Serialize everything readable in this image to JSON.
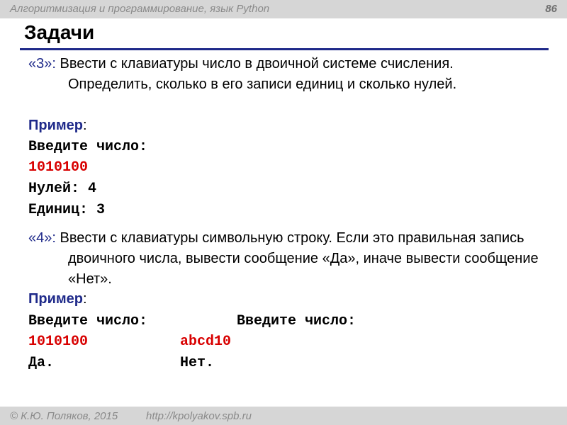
{
  "header": {
    "course_title": "Алгоритмизация и программирование, язык Python",
    "page_number": "86"
  },
  "slide_title": "Задачи",
  "task3": {
    "num": "«3»",
    "colon": ":",
    "text": " Ввести с клавиатуры число в двоичной системе счисления. Определить, сколько в его записи единиц и сколько нулей.",
    "example_label": "Пример",
    "example_colon": ":",
    "prompt": "Введите число:",
    "input": "1010100",
    "zeros_line": "Нулей: 4",
    "ones_line": "Единиц: 3"
  },
  "task4": {
    "num": "«4»",
    "colon": ":",
    "text": " Ввести с клавиатуры символьную строку. Если это правильная запись двоичного числа, вывести сообщение «Да», иначе вывести сообщение «Нет».",
    "example_label": "Пример",
    "example_colon": ":",
    "example1": {
      "prompt": "Введите число:",
      "input": "1010100",
      "output": "Да."
    },
    "example2": {
      "prompt": "Введите число:",
      "input": "abcd10",
      "output": "Нет."
    }
  },
  "footer": {
    "copyright": "© К.Ю. Поляков, 2015",
    "url": "http://kpolyakov.spb.ru"
  },
  "colors": {
    "accent_blue": "#1f2a8a",
    "highlight_red": "#d80000",
    "bar_gray": "#d6d6d6"
  }
}
